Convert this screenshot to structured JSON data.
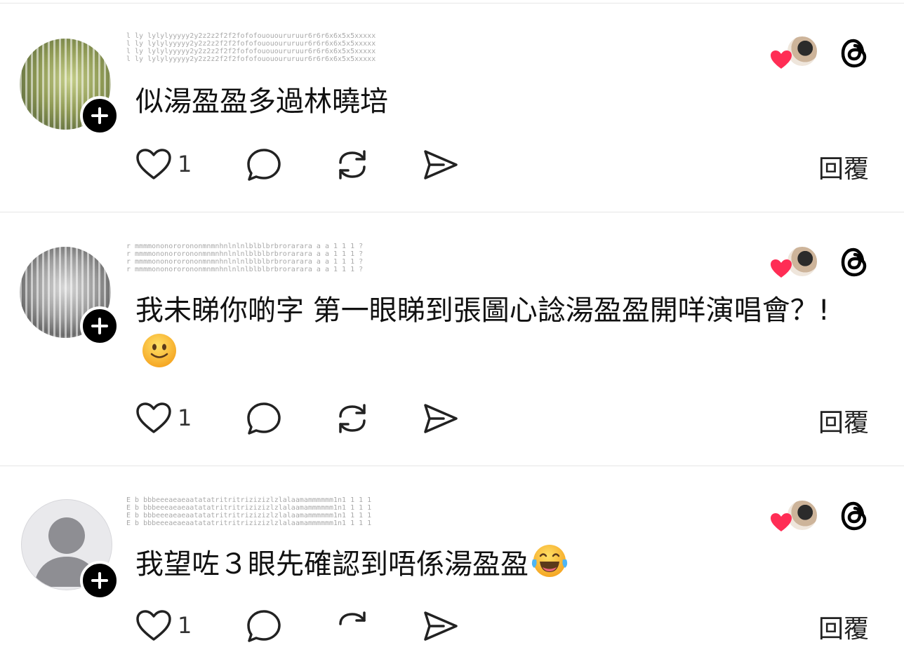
{
  "comments": [
    {
      "username_mask": "l ly lylylyyyyy2y2z2z2f2f2fofofouououruruur6r6r6x6x5x5xxxxx",
      "text": "似湯盈盈多過林曉培",
      "like_count": "1",
      "reply_label": "回覆",
      "avatar": "photo-green"
    },
    {
      "username_mask": "r mmmmononororononmnmnhnlnlnlblblbrbrorarara a a 1 1 1 ?",
      "text": "我未睇你啲字 第一眼睇到張圖心諗湯盈盈開咩演唱會？!",
      "emoji": "slightly-smiling-face",
      "like_count": "1",
      "reply_label": "回覆",
      "avatar": "photo-gray"
    },
    {
      "username_mask": "E b bbbeeeaeaeaatatatritritrizizizlzlalaamammmmmm1n1 1 1 1",
      "text": "我望咗３眼先確認到唔係湯盈盈",
      "emoji": "face-with-tears-of-joy",
      "like_count": "1",
      "reply_label": "回覆",
      "avatar": "default-person"
    }
  ],
  "icons": {
    "like": "heart-outline-icon",
    "comment": "speech-bubble-icon",
    "repost": "repost-icon",
    "share": "send-icon",
    "app": "threads-logo-icon",
    "liked_by_author": "red-heart-icon"
  },
  "colors": {
    "heart_red": "#ff2d55",
    "text": "#111111",
    "divider": "#e6e6e6"
  }
}
